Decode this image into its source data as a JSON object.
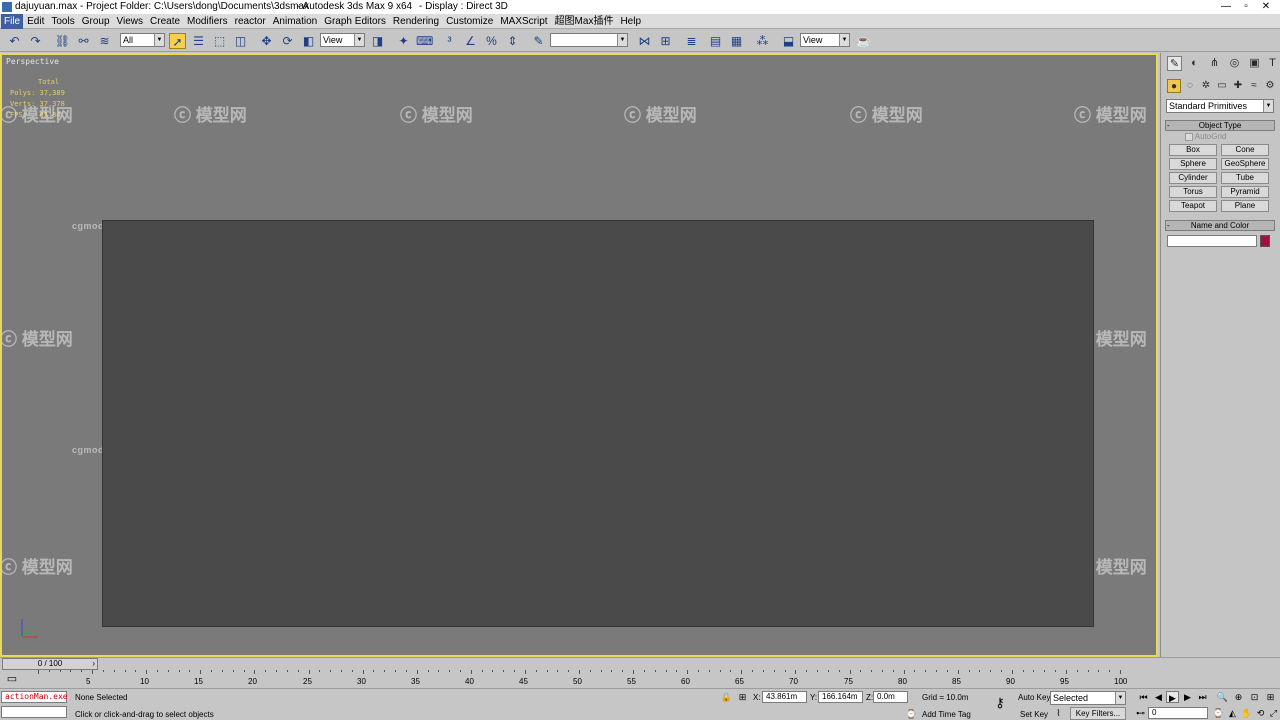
{
  "titlebar": {
    "file": "dajuyuan.max",
    "project": "- Project Folder: C:\\Users\\dong\\Documents\\3dsmax",
    "app": "- Autodesk 3ds Max 9 x64",
    "display": "- Display : Direct 3D",
    "min": "—",
    "max": "▫",
    "close": "✕"
  },
  "menu": [
    "File",
    "Edit",
    "Tools",
    "Group",
    "Views",
    "Create",
    "Modifiers",
    "reactor",
    "Animation",
    "Graph Editors",
    "Rendering",
    "Customize",
    "MAXScript",
    "超图Max插件",
    "Help"
  ],
  "toolbar": {
    "filter_value": "All",
    "refcoord_value": "View",
    "named_sel_value": "",
    "render_view_value": "View"
  },
  "viewport": {
    "label": "Perspective",
    "stats": {
      "total_label": "Total",
      "polys_label": "Polys:",
      "polys_value": "37,389",
      "verts_label": "Verts:",
      "verts_value": "37,378",
      "fps_label": "FPS:",
      "fps_value": "65.34"
    },
    "watermark_cn": "模型网",
    "watermark_url": "cgmodel.com"
  },
  "command_panel": {
    "dropdown_value": "Standard Primitives",
    "object_type_title": "Object Type",
    "autogrid_label": "AutoGrid",
    "buttons": [
      "Box",
      "Cone",
      "Sphere",
      "GeoSphere",
      "Cylinder",
      "Tube",
      "Torus",
      "Pyramid",
      "Teapot",
      "Plane"
    ],
    "name_color_title": "Name and Color",
    "name_value": "",
    "swatch_color": "#a01040"
  },
  "timeline": {
    "frame_display": "0 / 100",
    "ticks": [
      "0",
      "5",
      "10",
      "15",
      "20",
      "25",
      "30",
      "35",
      "40",
      "45",
      "50",
      "55",
      "60",
      "65",
      "70",
      "75",
      "80",
      "85",
      "90",
      "95",
      "100"
    ]
  },
  "status": {
    "script_listener": "actionMan.exe",
    "selection": "None Selected",
    "prompt": "Click or click-and-drag to select objects",
    "x_label": "X:",
    "x_value": "43.861m",
    "y_label": "Y:",
    "y_value": "166.164m",
    "z_label": "Z:",
    "z_value": "0.0m",
    "grid": "Grid = 10.0m",
    "add_time_tag": "Add Time Tag",
    "auto_key": "Auto Key",
    "set_key": "Set Key",
    "selected_value": "Selected",
    "key_filters": "Key Filters...",
    "frame_value": "0"
  }
}
